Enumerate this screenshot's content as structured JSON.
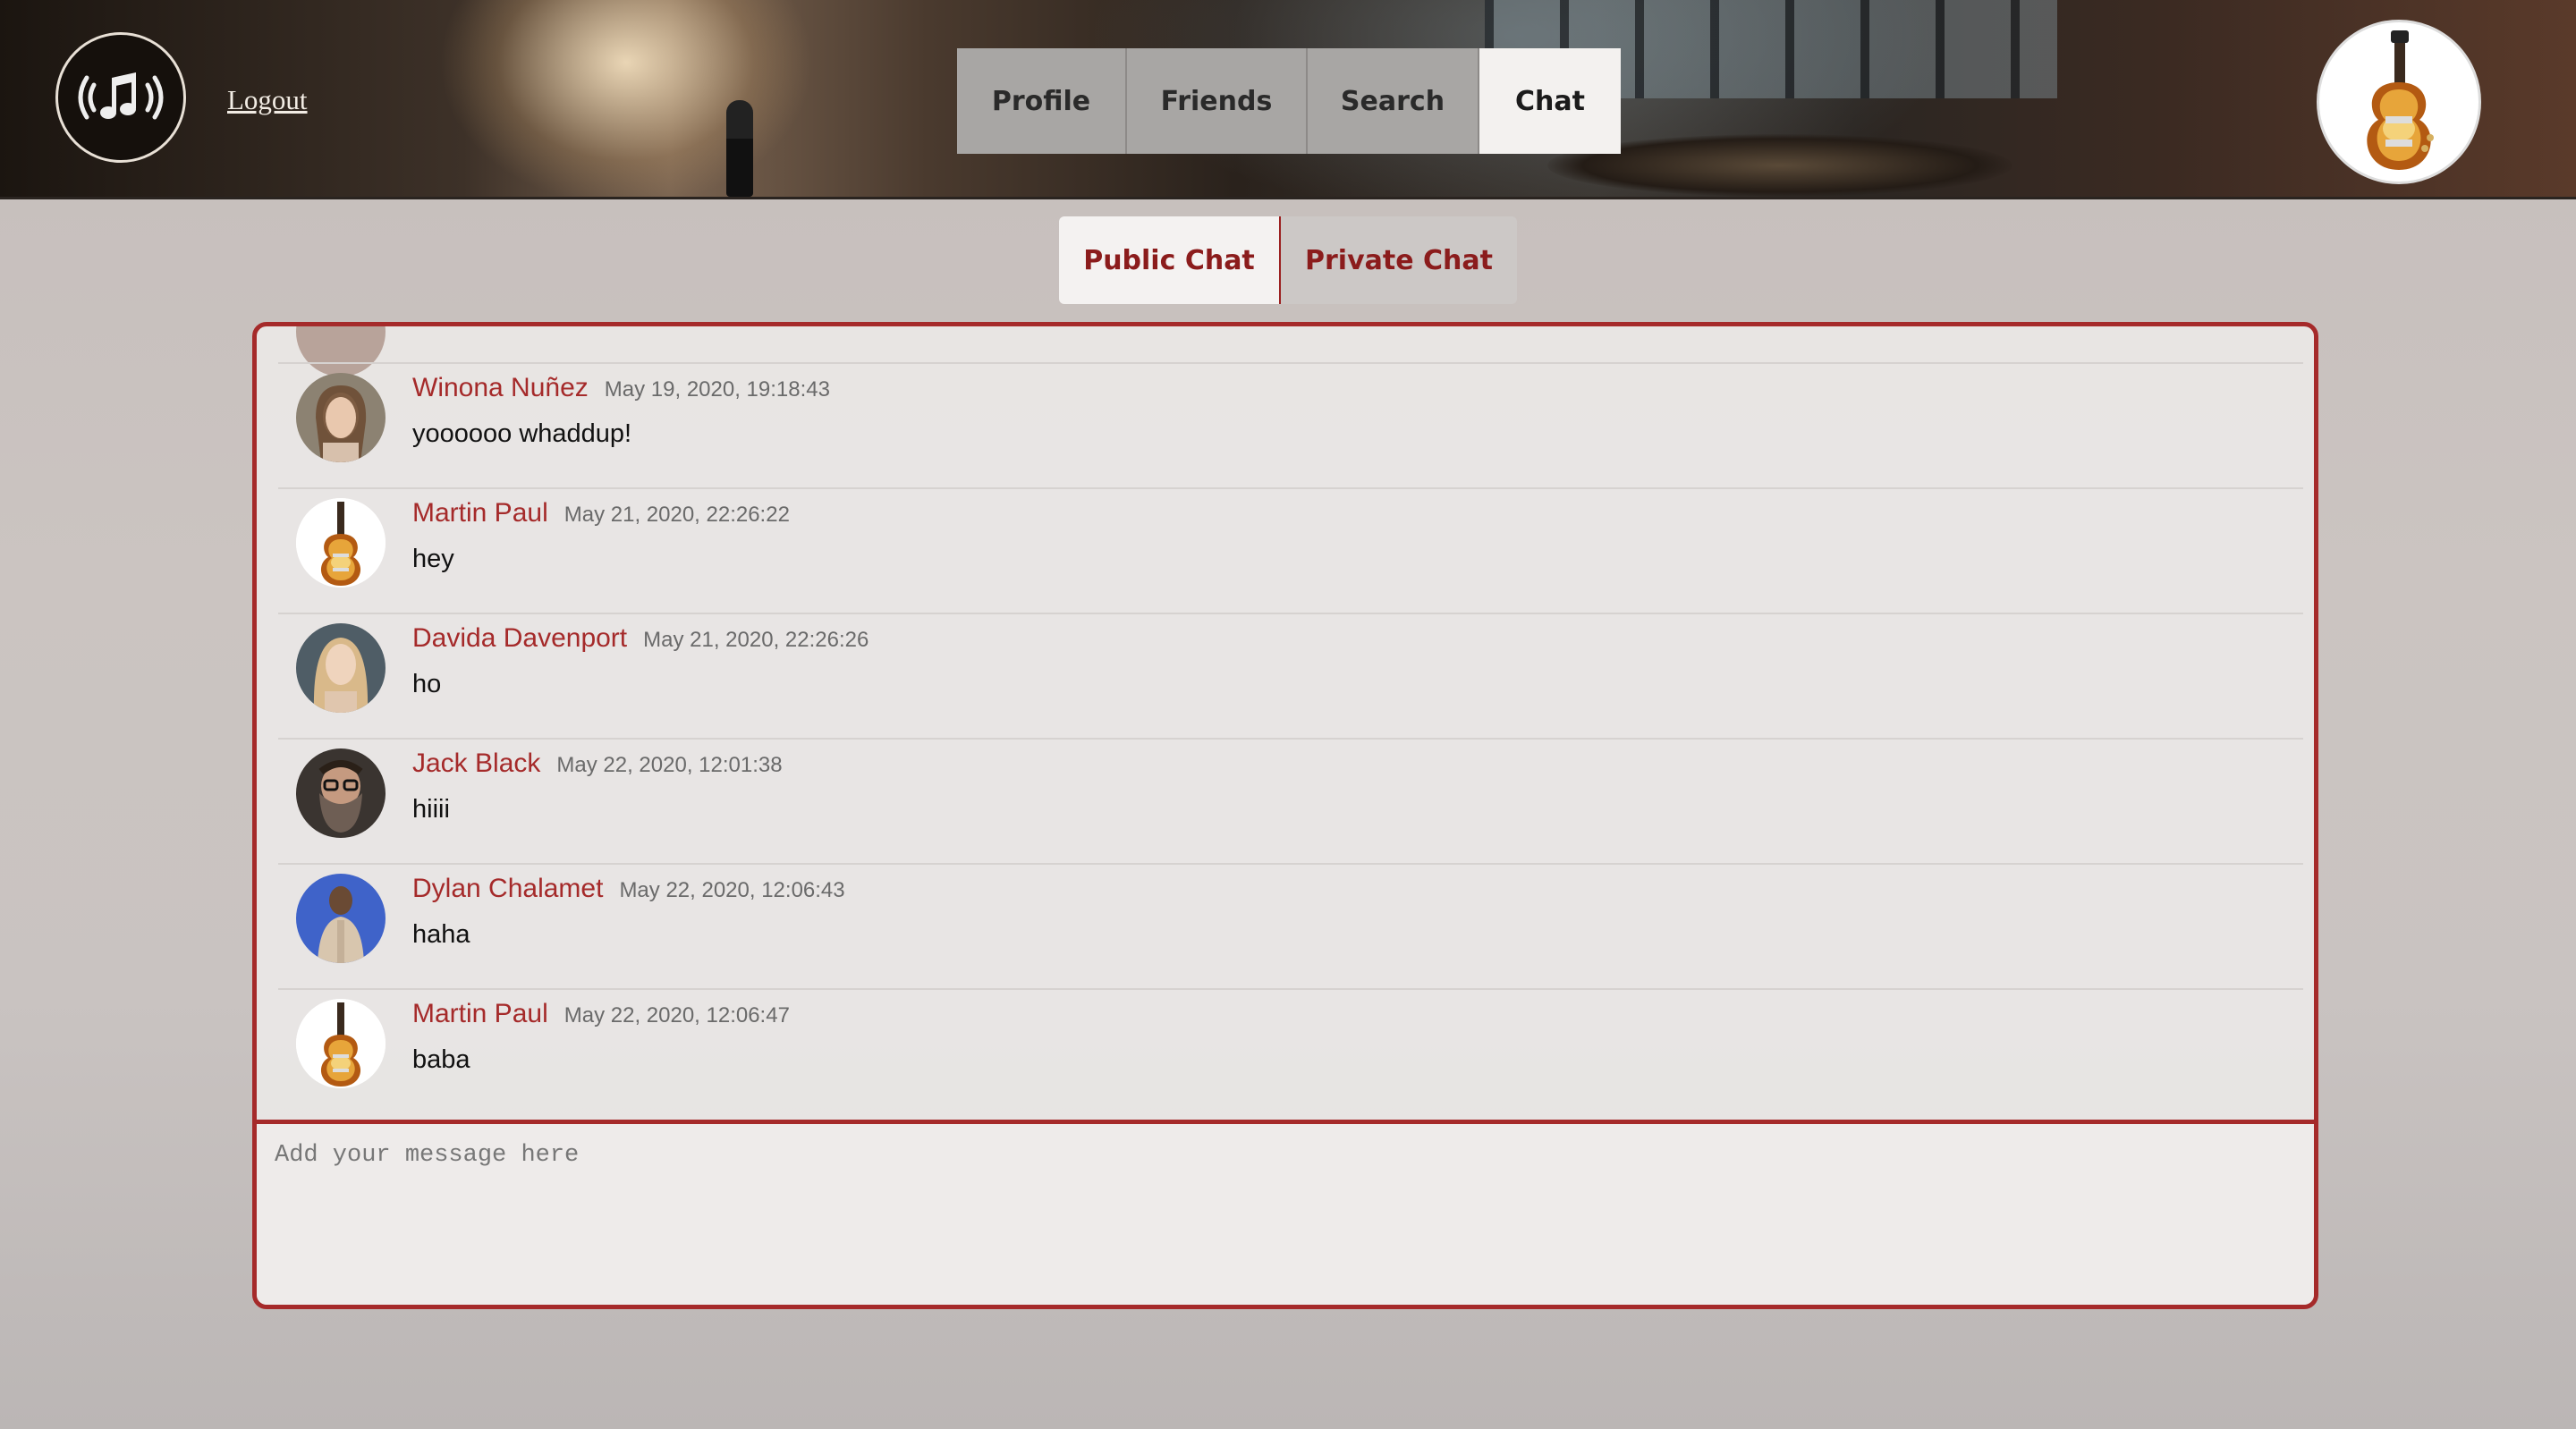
{
  "header": {
    "logout_label": "Logout",
    "nav": [
      {
        "label": "Profile",
        "active": false
      },
      {
        "label": "Friends",
        "active": false
      },
      {
        "label": "Search",
        "active": false
      },
      {
        "label": "Chat",
        "active": true
      }
    ],
    "logo_icon": "music-broadcast-icon",
    "profile_avatar_icon": "guitar-avatar"
  },
  "chat_tabs": [
    {
      "label": "Public Chat",
      "active": true
    },
    {
      "label": "Private Chat",
      "active": false
    }
  ],
  "messages": [
    {
      "name": "Winona Nuñez",
      "time": "May 19, 2020, 19:18:43",
      "text": "yoooooo whaddup!",
      "avatar": "photo"
    },
    {
      "name": "Martin Paul",
      "time": "May 21, 2020, 22:26:22",
      "text": "hey",
      "avatar": "guitar"
    },
    {
      "name": "Davida Davenport",
      "time": "May 21, 2020, 22:26:26",
      "text": "ho",
      "avatar": "photo"
    },
    {
      "name": "Jack Black",
      "time": "May 22, 2020, 12:01:38",
      "text": "hiiii",
      "avatar": "photo"
    },
    {
      "name": "Dylan Chalamet",
      "time": "May 22, 2020, 12:06:43",
      "text": "haha",
      "avatar": "photo"
    },
    {
      "name": "Martin Paul",
      "time": "May 22, 2020, 12:06:47",
      "text": "baba",
      "avatar": "guitar"
    }
  ],
  "composer": {
    "placeholder": "Add your message here"
  },
  "colors": {
    "accent": "#a52a2a",
    "active_tab": "#f3f1ef",
    "inactive_tab": "#a8a6a4"
  }
}
